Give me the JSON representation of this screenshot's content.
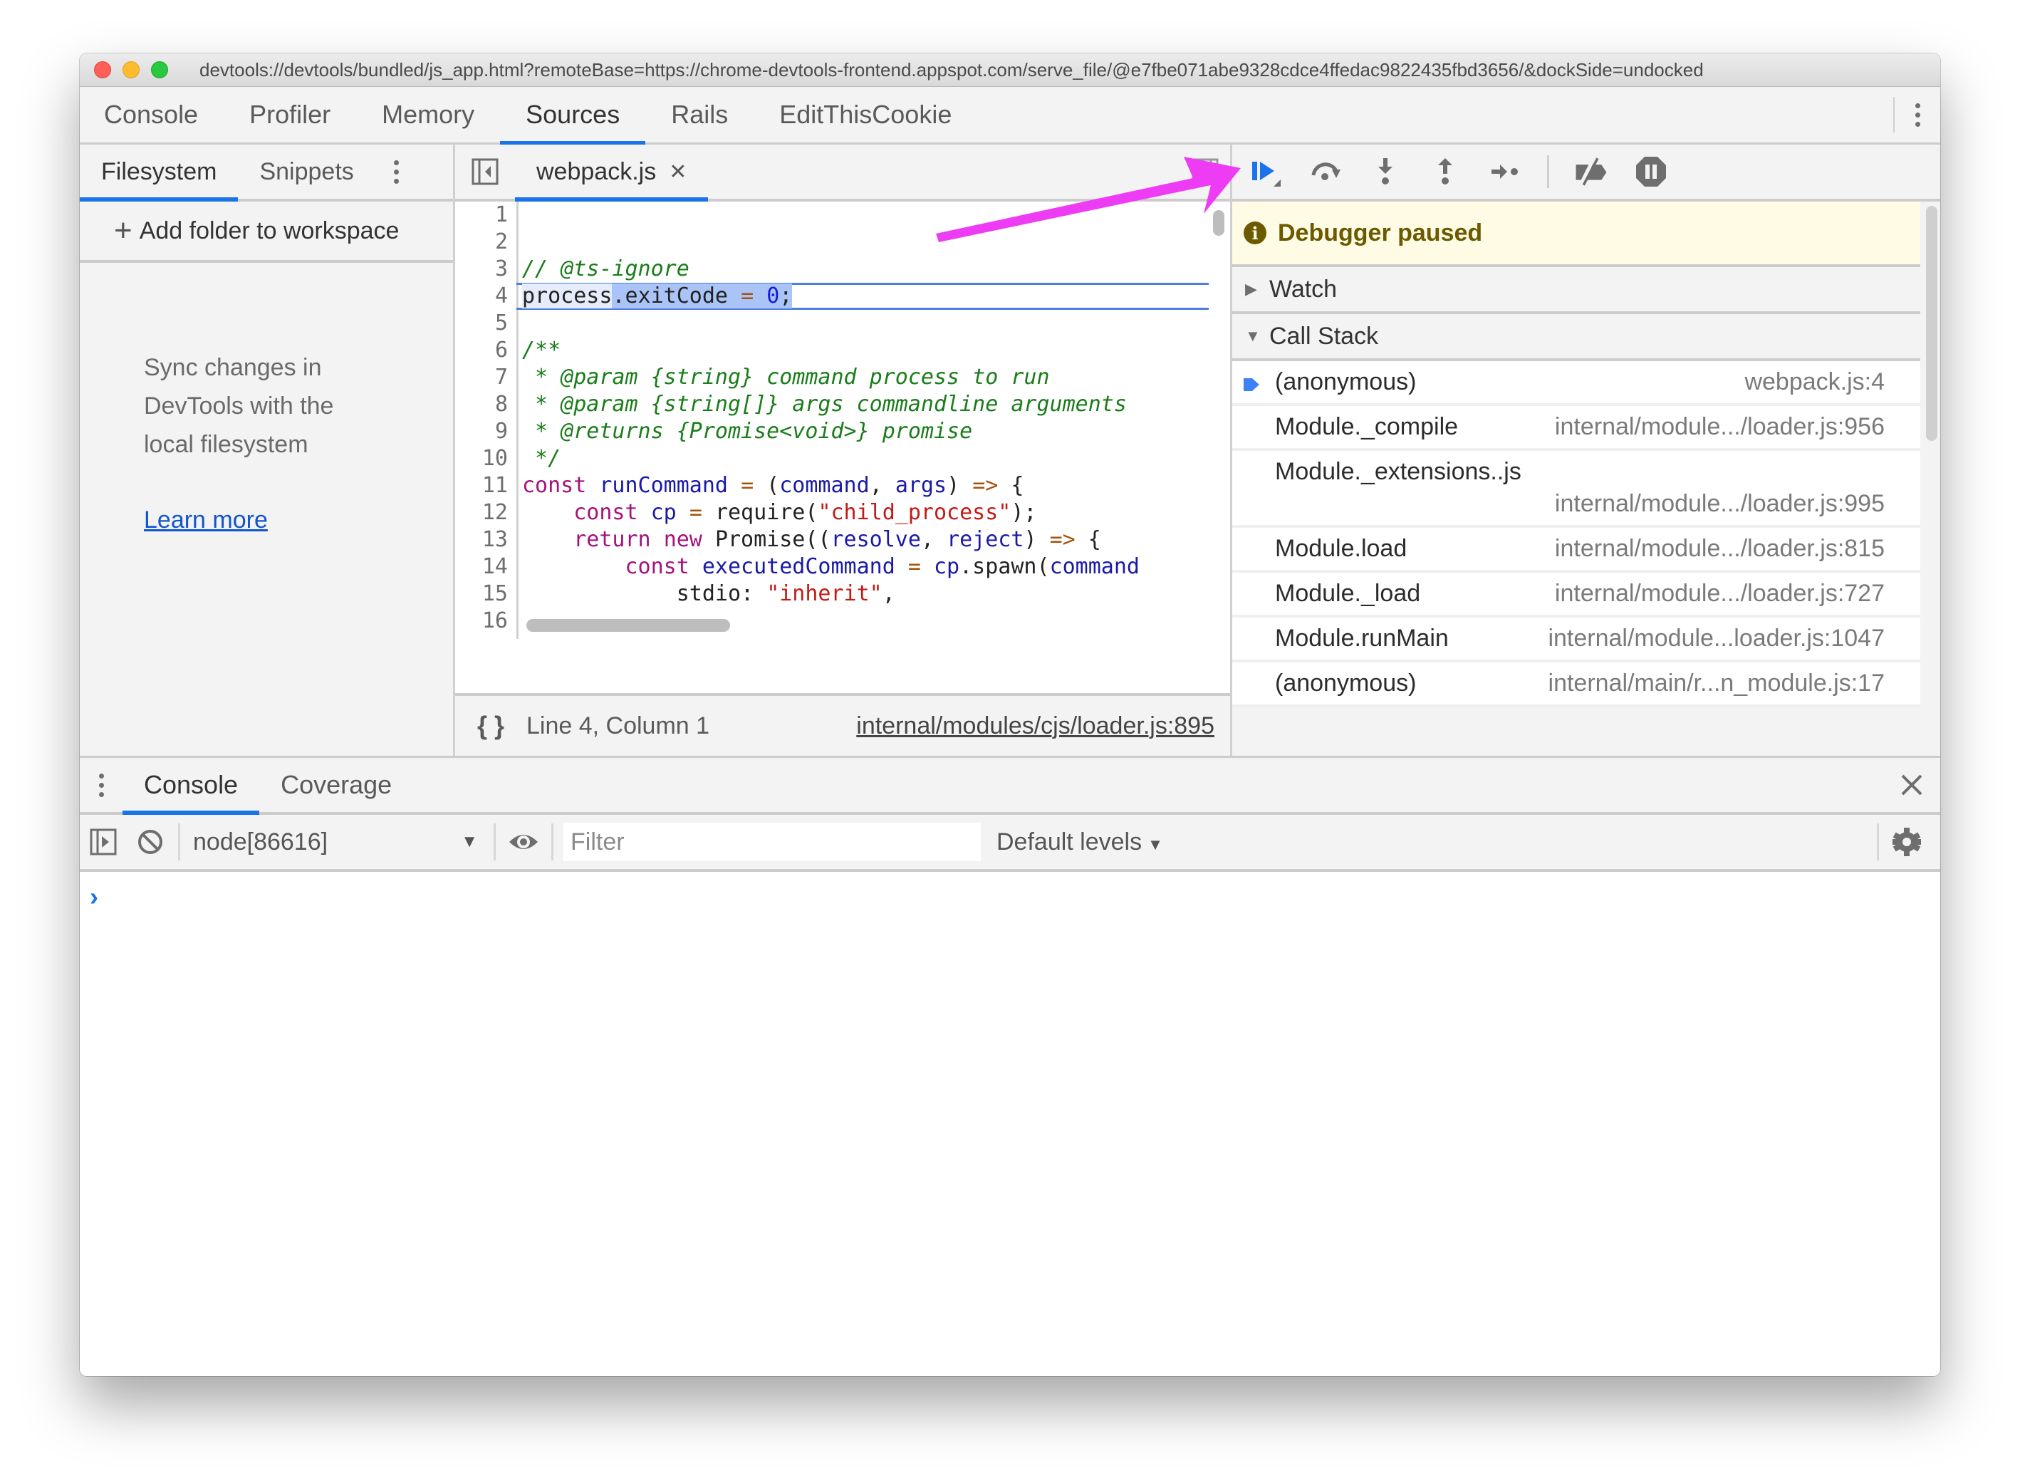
{
  "window": {
    "title": "devtools://devtools/bundled/js_app.html?remoteBase=https://chrome-devtools-frontend.appspot.com/serve_file/@e7fbe071abe9328cdce4ffedac9822435fbd3656/&dockSide=undocked"
  },
  "main_tabs": [
    {
      "label": "Console",
      "active": false
    },
    {
      "label": "Profiler",
      "active": false
    },
    {
      "label": "Memory",
      "active": false
    },
    {
      "label": "Sources",
      "active": true
    },
    {
      "label": "Rails",
      "active": false
    },
    {
      "label": "EditThisCookie",
      "active": false
    }
  ],
  "navigator": {
    "tabs": [
      {
        "label": "Filesystem",
        "active": true
      },
      {
        "label": "Snippets",
        "active": false
      }
    ],
    "add_folder_label": "Add folder to workspace",
    "sync_text": "Sync changes in DevTools with the local filesystem",
    "learn_more_label": "Learn more"
  },
  "editor": {
    "file_tab": "webpack.js",
    "current_line": 4,
    "lines": [
      {
        "n": "1"
      },
      {
        "n": "2"
      },
      {
        "n": "3"
      },
      {
        "n": "4"
      },
      {
        "n": "5"
      },
      {
        "n": "6"
      },
      {
        "n": "7"
      },
      {
        "n": "8"
      },
      {
        "n": "9"
      },
      {
        "n": "10"
      },
      {
        "n": "11"
      },
      {
        "n": "12"
      },
      {
        "n": "13"
      },
      {
        "n": "14"
      },
      {
        "n": "15"
      },
      {
        "n": "16"
      }
    ],
    "code": {
      "l3": "// @ts-ignore",
      "l4_a": "process",
      "l4_b": ".exitCode ",
      "l4_op": "=",
      "l4_sp": " ",
      "l4_num": "0",
      "l4_end": ";",
      "l6": "/**",
      "l7": " * @param {string} command process to run",
      "l8": " * @param {string[]} args commandline arguments",
      "l9": " * @returns {Promise<void>} promise",
      "l10": " */",
      "l11_kw": "const",
      "l11_name": "runCommand",
      "l11_eq": "=",
      "l11_p1": "command",
      "l11_p2": "args",
      "l11_arrow": "=>",
      "l12_kw": "const",
      "l12_name": "cp",
      "l12_eq": "=",
      "l12_fn": "require(",
      "l12_str": "\"child_process\"",
      "l12_end": ");",
      "l13_kw1": "return",
      "l13_kw2": "new",
      "l13_fn": "Promise((",
      "l13_p1": "resolve",
      "l13_p2": "reject",
      "l13_arrow": "=>",
      "l14_kw": "const",
      "l14_name": "executedCommand",
      "l14_eq": "=",
      "l14_obj": "cp",
      "l14_fn": ".spawn(",
      "l14_arg": "command",
      "l15_key": "stdio: ",
      "l15_str": "\"inherit\"",
      "l15_end": ","
    },
    "status": {
      "cursor": "Line 4, Column 1",
      "source_link": "internal/modules/cjs/loader.js:895"
    }
  },
  "debugger": {
    "toolbar": [
      {
        "icon": "resume-icon",
        "label": "Resume script execution"
      },
      {
        "icon": "step-over-icon",
        "label": "Step over next function call"
      },
      {
        "icon": "step-into-icon",
        "label": "Step into next function call"
      },
      {
        "icon": "step-out-icon",
        "label": "Step out of current function"
      },
      {
        "icon": "step-icon",
        "label": "Step"
      },
      {
        "icon": "deactivate-breakpoints-icon",
        "label": "Deactivate breakpoints"
      },
      {
        "icon": "pause-on-exceptions-icon",
        "label": "Pause on exceptions"
      }
    ],
    "paused_message": "Debugger paused",
    "watch_label": "Watch",
    "call_stack_label": "Call Stack",
    "call_stack": [
      {
        "fn": "(anonymous)",
        "loc": "webpack.js:4",
        "current": true
      },
      {
        "fn": "Module._compile",
        "loc": "internal/module.../loader.js:956"
      },
      {
        "fn": "Module._extensions..js",
        "loc": "internal/module.../loader.js:995"
      },
      {
        "fn": "Module.load",
        "loc": "internal/module.../loader.js:815"
      },
      {
        "fn": "Module._load",
        "loc": "internal/module.../loader.js:727"
      },
      {
        "fn": "Module.runMain",
        "loc": "internal/module...loader.js:1047"
      },
      {
        "fn": "(anonymous)",
        "loc": "internal/main/r...n_module.js:17"
      }
    ]
  },
  "drawer": {
    "tabs": [
      {
        "label": "Console",
        "active": true
      },
      {
        "label": "Coverage",
        "active": false
      }
    ],
    "context": "node[86616]",
    "filter_placeholder": "Filter",
    "filter_value": "",
    "levels_label": "Default levels",
    "prompt": "›"
  },
  "annotation": {
    "arrow_color": "#ee3cf5",
    "points_to": "resume-icon"
  },
  "colors": {
    "accent": "#1a73e8",
    "paused_bg": "#fffbe4",
    "paused_text": "#6b5a00"
  }
}
